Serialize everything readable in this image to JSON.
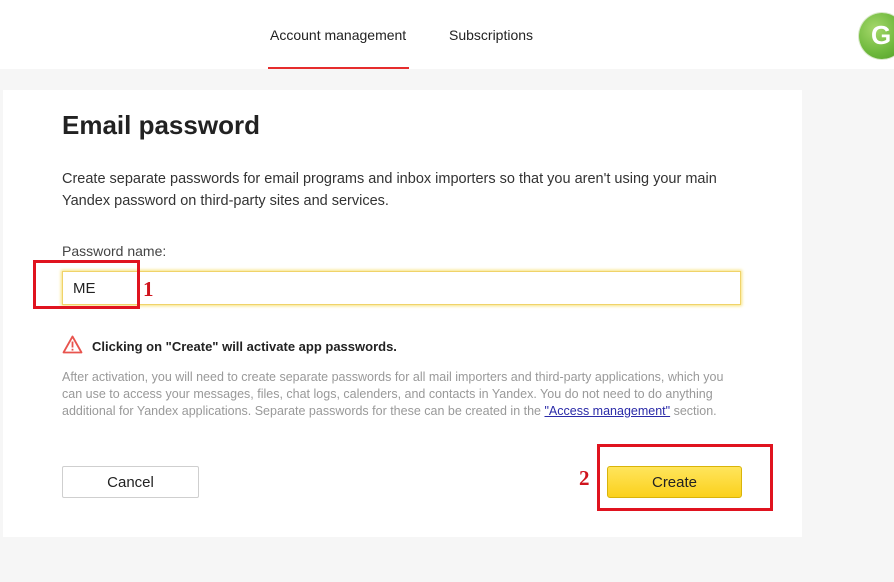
{
  "nav": {
    "tabs": [
      {
        "label": "Account management",
        "active": true
      },
      {
        "label": "Subscriptions",
        "active": false
      }
    ],
    "logo_icon": "globe-logo-icon",
    "logo_letter": "G",
    "accent_color": "#e62d2d"
  },
  "dialog": {
    "title": "Email password",
    "description": "Create separate passwords for email programs and inbox importers so that you aren't using your main Yandex password on third-party sites and services.",
    "field_label": "Password name:",
    "field_value": "ME",
    "warning_icon": "warning-triangle-icon",
    "warning_text": "Clicking on \"Create\" will activate app passwords.",
    "note_text": "After activation, you will need to create separate passwords for all mail importers and third-party applications, which you can use to access your messages, files, chat logs, calenders, and contacts in Yandex. You do not need to do anything additional for Yandex applications. Separate passwords for these can be created in the ",
    "note_link": "\"Access management\"",
    "note_suffix": " section.",
    "cancel_label": "Cancel",
    "create_label": "Create",
    "create_color": "#fbd11c"
  },
  "annotations": {
    "step1": "1",
    "step2": "2",
    "color": "#e0131f"
  }
}
